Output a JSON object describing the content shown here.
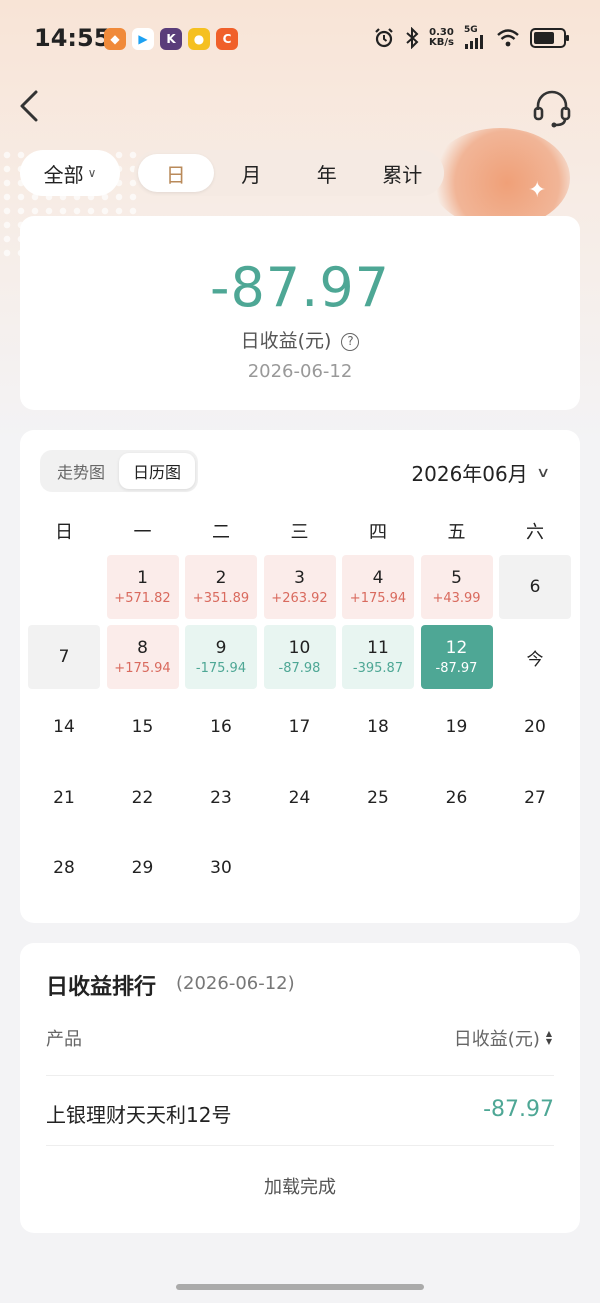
{
  "status_bar": {
    "time": "14:55",
    "net_speed_value": "0.30",
    "net_speed_unit": "KB/s",
    "signal_label": "5G",
    "app_icons": [
      "app-orange-icon",
      "app-play-icon",
      "app-k-icon",
      "app-yellow-icon",
      "app-c-icon"
    ]
  },
  "nav": {
    "back_icon": "chevron-left-icon",
    "service_icon": "headset-icon"
  },
  "filter": {
    "account_select": "全部",
    "tabs": [
      {
        "label": "日",
        "active": true
      },
      {
        "label": "月",
        "active": false
      },
      {
        "label": "年",
        "active": false
      },
      {
        "label": "累计",
        "active": false
      }
    ]
  },
  "summary": {
    "value": "-87.97",
    "label": "日收益(元)",
    "help": "?",
    "date": "2026-06-12"
  },
  "calendar": {
    "view_tabs": [
      {
        "label": "走势图",
        "active": false
      },
      {
        "label": "日历图",
        "active": true
      }
    ],
    "month": "2026年06月",
    "weekdays": [
      "日",
      "一",
      "二",
      "三",
      "四",
      "五",
      "六"
    ],
    "days": [
      {
        "d": "1",
        "v": "+571.82",
        "state": "pos"
      },
      {
        "d": "2",
        "v": "+351.89",
        "state": "pos"
      },
      {
        "d": "3",
        "v": "+263.92",
        "state": "pos"
      },
      {
        "d": "4",
        "v": "+175.94",
        "state": "pos"
      },
      {
        "d": "5",
        "v": "+43.99",
        "state": "pos"
      },
      {
        "d": "6",
        "v": "",
        "state": "zero"
      },
      {
        "d": "7",
        "v": "",
        "state": "zero"
      },
      {
        "d": "8",
        "v": "+175.94",
        "state": "pos"
      },
      {
        "d": "9",
        "v": "-175.94",
        "state": "neg"
      },
      {
        "d": "10",
        "v": "-87.98",
        "state": "neg"
      },
      {
        "d": "11",
        "v": "-395.87",
        "state": "neg"
      },
      {
        "d": "12",
        "v": "-87.97",
        "state": "sel"
      },
      {
        "d": "今",
        "v": "",
        "state": "plain"
      },
      {
        "d": "14",
        "v": "",
        "state": "plain"
      },
      {
        "d": "15",
        "v": "",
        "state": "plain"
      },
      {
        "d": "16",
        "v": "",
        "state": "plain"
      },
      {
        "d": "17",
        "v": "",
        "state": "plain"
      },
      {
        "d": "18",
        "v": "",
        "state": "plain"
      },
      {
        "d": "19",
        "v": "",
        "state": "plain"
      },
      {
        "d": "20",
        "v": "",
        "state": "plain"
      },
      {
        "d": "21",
        "v": "",
        "state": "plain"
      },
      {
        "d": "22",
        "v": "",
        "state": "plain"
      },
      {
        "d": "23",
        "v": "",
        "state": "plain"
      },
      {
        "d": "24",
        "v": "",
        "state": "plain"
      },
      {
        "d": "25",
        "v": "",
        "state": "plain"
      },
      {
        "d": "26",
        "v": "",
        "state": "plain"
      },
      {
        "d": "27",
        "v": "",
        "state": "plain"
      },
      {
        "d": "28",
        "v": "",
        "state": "plain"
      },
      {
        "d": "29",
        "v": "",
        "state": "plain"
      },
      {
        "d": "30",
        "v": "",
        "state": "plain"
      }
    ]
  },
  "ranking": {
    "title": "日收益排行",
    "date": "(2026-06-12)",
    "col_product": "产品",
    "col_income": "日收益(元)",
    "rows": [
      {
        "name": "上银理财天天利12号",
        "value": "-87.97"
      }
    ],
    "footer": "加载完成"
  },
  "colors": {
    "negative": "#4ea795",
    "positive": "#d96a5e",
    "accent_gold": "#b98a5a"
  }
}
